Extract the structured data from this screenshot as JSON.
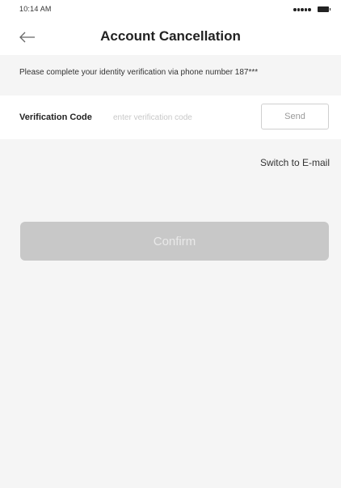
{
  "status_bar": {
    "time": "10:14 AM",
    "signal_icon": "signal-dots-icon",
    "battery_icon": "battery-icon"
  },
  "header": {
    "back_icon": "arrow-left-icon",
    "title": "Account Cancellation"
  },
  "notice": {
    "text": "Please complete your identity verification via phone number 187***"
  },
  "form": {
    "code_label": "Verification Code",
    "code_value": "",
    "code_placeholder": "enter verification code",
    "send_label": "Send"
  },
  "switch_link": "Switch to E-mail",
  "confirm": {
    "label": "Confirm",
    "enabled": false
  },
  "colors": {
    "background": "#f5f5f5",
    "surface": "#ffffff",
    "confirm_disabled": "#c8c8c8",
    "text_primary": "#222222"
  }
}
